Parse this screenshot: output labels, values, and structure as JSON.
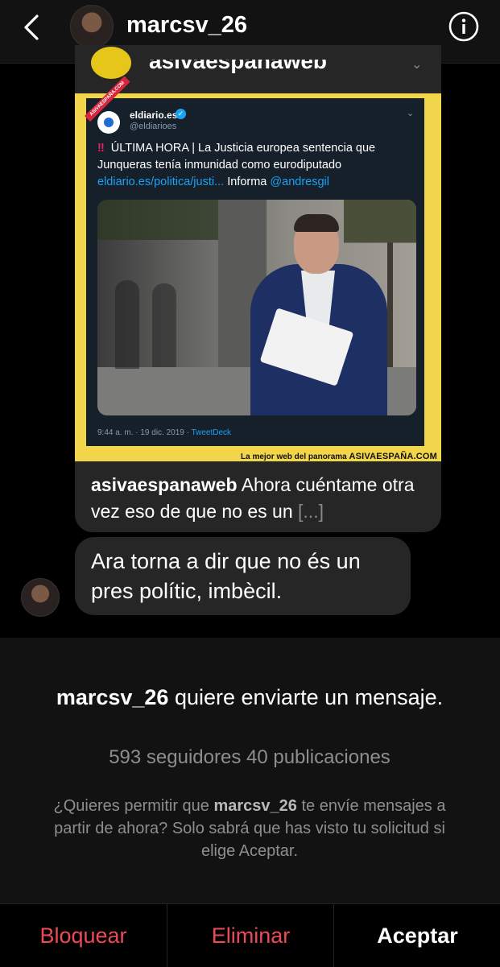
{
  "header": {
    "username": "marcsv_26"
  },
  "shared_post": {
    "author_top": "asivaespanaweb",
    "image": {
      "tweet": {
        "name": "eldiario.es",
        "handle": "@eldiarioes",
        "alert_icon": "‼",
        "text_main": "ÚLTIMA HORA | La Justicia europea sentencia que Junqueras tenía inmunidad como eurodiputado",
        "link": "eldiario.es/politica/justi...",
        "text_after_link": "Informa",
        "mention": "@andresgil",
        "time": "9:44 a. m. · 19 dic. 2019 ·",
        "client": "TweetDeck"
      },
      "watermark_tag": "ASIVAESPAÑA.COM",
      "footer_tagline": "La mejor web del panorama",
      "footer_brand": "ASIVAESPAÑA.COM"
    },
    "caption": {
      "author": "asivaespanaweb",
      "text": "Ahora cuéntame otra vez eso de que no es un",
      "more": "[...]"
    }
  },
  "message": {
    "text": "Ara torna a dir que no és un pres polític, imbècil."
  },
  "request": {
    "username": "marcsv_26",
    "title_rest": "quiere enviarte un mensaje.",
    "stats": "593 seguidores 40 publicaciones",
    "help_before": "¿Quieres permitir que",
    "help_user": "marcsv_26",
    "help_after": "te envíe mensajes a partir de ahora? Solo sabrá que has visto tu solicitud si elige Aceptar."
  },
  "actions": {
    "block": "Bloquear",
    "delete": "Eliminar",
    "accept": "Aceptar"
  },
  "colors": {
    "danger": "#ed4956",
    "bubble": "#262626",
    "panel": "#121212"
  }
}
